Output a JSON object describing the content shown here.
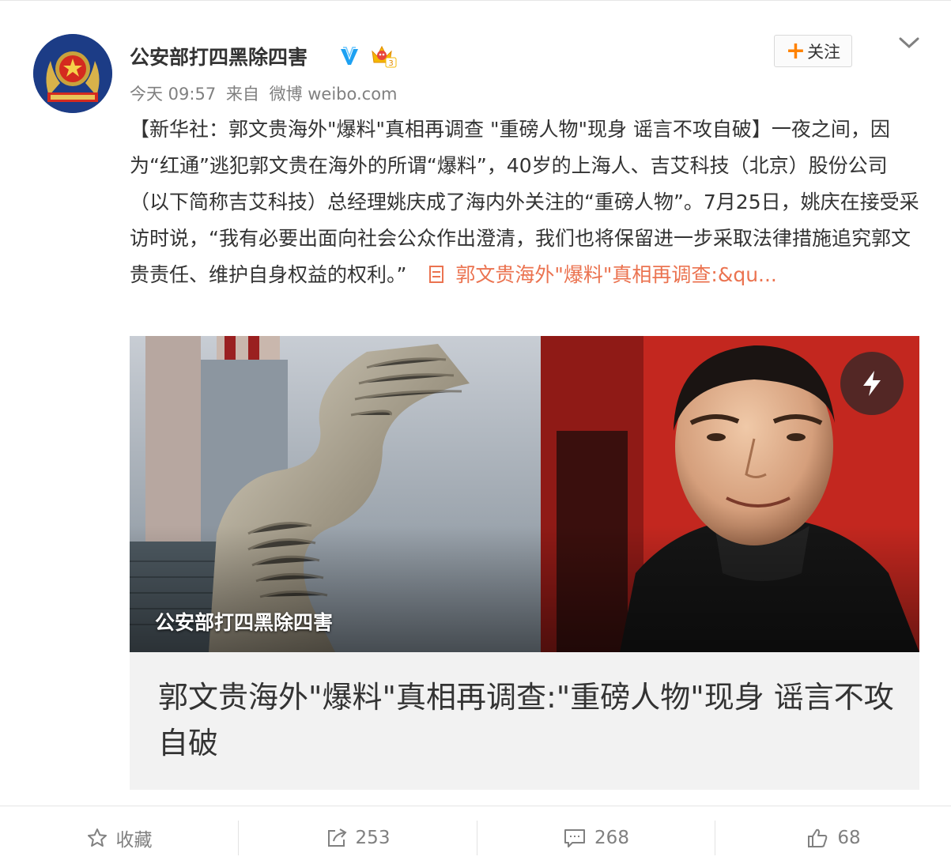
{
  "post": {
    "author": {
      "name": "公安部打四黑除四害",
      "avatar_icon": "police-emblem-icon",
      "verified_icon": "verified-v-icon",
      "vip_icon": "vip-crown-icon",
      "vip_level": "3"
    },
    "meta": {
      "time": "今天 09:57",
      "source_prefix": "来自",
      "source": "微博 weibo.com"
    },
    "follow_label": "关注",
    "follow_plus": "+",
    "text": {
      "body": "【新华社：郭文贵海外\"爆料\"真相再调查 \"重磅人物\"现身 谣言不攻自破】一夜之间，因为“红通”逃犯郭文贵在海外的所谓“爆料”，40岁的上海人、吉艾科技（北京）股份公司（以下简称吉艾科技）总经理姚庆成了海内外关注的“重磅人物”。7月25日，姚庆在接受采访时说，“我有必要出面向社会公众作出澄清，我们也将保留进一步采取法律措施追究郭文贵责任、维护自身权益的权利。”",
      "link": "郭文贵海外\"爆料\"真相再调查:&qu..."
    },
    "media": {
      "caption": "公安部打四黑除四害",
      "play_icon": "lightning-icon"
    },
    "card_title": "郭文贵海外\"爆料\"真相再调查:\"重磅人物\"现身 谣言不攻自破"
  },
  "actions": {
    "favorite": {
      "label": "收藏",
      "icon": "star-icon"
    },
    "repost": {
      "count": "253",
      "icon": "share-icon"
    },
    "comment": {
      "count": "268",
      "icon": "comment-icon"
    },
    "like": {
      "count": "68",
      "icon": "thumbs-up-icon"
    }
  },
  "colors": {
    "link": "#eb7350",
    "follow_plus": "#ff8200",
    "verified": "#1da1f2",
    "muted": "#808080"
  }
}
